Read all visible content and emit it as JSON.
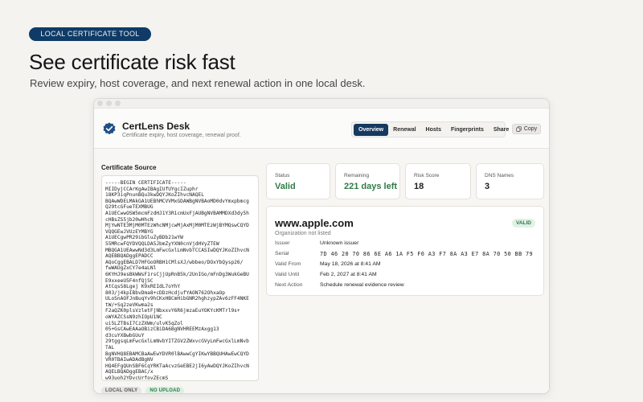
{
  "hero": {
    "pill": "LOCAL CERTIFICATE TOOL",
    "title": "See certificate risk fast",
    "subtitle": "Review expiry, host coverage, and next renewal action in one local desk."
  },
  "app": {
    "name": "CertLens Desk",
    "tagline": "Certificate expiry, host coverage, renewal proof.",
    "logo_icon": "shield-check-icon",
    "tabs": [
      {
        "label": "Overview",
        "active": true
      },
      {
        "label": "Renewal",
        "active": false
      },
      {
        "label": "Hosts",
        "active": false
      },
      {
        "label": "Fingerprints",
        "active": false
      },
      {
        "label": "Share",
        "active": false
      }
    ],
    "copy_label": "Copy",
    "copy_icon": "copy-icon"
  },
  "source": {
    "label": "Certificate Source",
    "pem": "-----BEGIN CERTIFICATE-----\nMIIDyjCCArKgAwIBAgIUfUYgcIZuphr\n18KP3iqPnunBQu3kwDQYJKoZIhvcNAQEL\nBQAwWDELMAkGA1UEBhMCVVMxGDAWBgNVBAoMD0dvYmxpbmcg\nQ29tcGFueTEXMBUG\nA1UECwwOSW5mcmFzdHJ1Y3R1cmUxFjAUBgNVBAMMDXd3dy5h\ncHBsZS5jb20wHhcN\nMjYwNTE3MjM0MTEzWhcNMjcwMjAxMjM0MTEzWjBYMQswCQYD\nVQQGEwJVUzEYMBYG\nA1UECgwPR29ibGluZyBDb21wYW\n55MRcwFQYDVQQLDA5JbmZyYXN0cnVjdHVyZTEW\nMBQGA1UEAwwNd3d3LmFwcGxlLmNvbTCCASIwDQYJKoZIhvcN\nAQEBBQADggEPADCC\nAQoCggEBALD7HFGoORBH1CMlsXJ/wbbeo/DOxYbQysp26/\nfwWAUgZxCY7e4aLNl\n6KYHJ9esBkWWsF1rsCjjUpRnB5k/2UnIGo/mFnDg3WukGeBU\nE9xxeeU5F4nfQjSC\nAtCqsS8Lgej K9xREIdL7oYhY\n803/j4kpIBbvDma8+cDDzHcdjufYAON762OhxaOp\nULoSnAOFJnBuqYv9hCKxHBCmHibGNR2hghzypZAv6zFF4NKE\ntW/+Sq2zeVKwma2s\nF2aQZK0plsVzletFjNbxxvY6R6jmzaEuYOKYcKMTrl9s+\noWYAZCSsN9zhIOpU1NC\nui5LZTBsI7CzZXWm/ulvK5qZol\n05+GsCAwEAAaOBizCBiDA6BgNVHREEMzAxgg13\nd3cuYXBwbGUuY\n29tggsqLmFwcGxlLmNvbYITZGV2ZWxvcGVyLmFwcGxlLmNvb\nTAL\nBgNVHQ8EBAMCBaAwEwYDVR0lBAwwCgYIKwYBBQUHAwEwCQYD\nVR0TBAIwADAdBgNV\nHQ4EFgQUnSBF6CqYRKTaAcvzGeEBE2jI6yAwDQYJKoZIhvcN\nAQELBQADggEBAC/x\nw93uoh2YDvcUrfovZEcmS"
  },
  "badges": [
    {
      "label": "LOCAL ONLY",
      "tone": "grey"
    },
    {
      "label": "NO UPLOAD",
      "tone": "green"
    }
  ],
  "stats": [
    {
      "label": "Status",
      "value": "Valid",
      "color": "#2f7a48"
    },
    {
      "label": "Remaining",
      "value": "221 days left",
      "color": "#2f7a48"
    },
    {
      "label": "Risk Score",
      "value": "18",
      "color": "#1d1d1f"
    },
    {
      "label": "DNS Names",
      "value": "3",
      "color": "#1d1d1f"
    }
  ],
  "detail": {
    "domain": "www.apple.com",
    "organization": "Organization not listed",
    "status_badge": "VALID",
    "rows": [
      {
        "label": "Issuer",
        "value": "Unknown issuer",
        "mono": false
      },
      {
        "label": "Serial",
        "value": "7D 46 20 70 86 6E A6 1A F5 F0 A3 F7 8A A3 E7 8A 70 50 BB 79",
        "mono": true
      },
      {
        "label": "Valid From",
        "value": "May 18, 2026 at 8:41 AM",
        "mono": false
      },
      {
        "label": "Valid Until",
        "value": "Feb 2, 2027 at 8:41 AM",
        "mono": false
      },
      {
        "label": "Next Action",
        "value": "Schedule renewal evidence review",
        "mono": false
      }
    ]
  }
}
